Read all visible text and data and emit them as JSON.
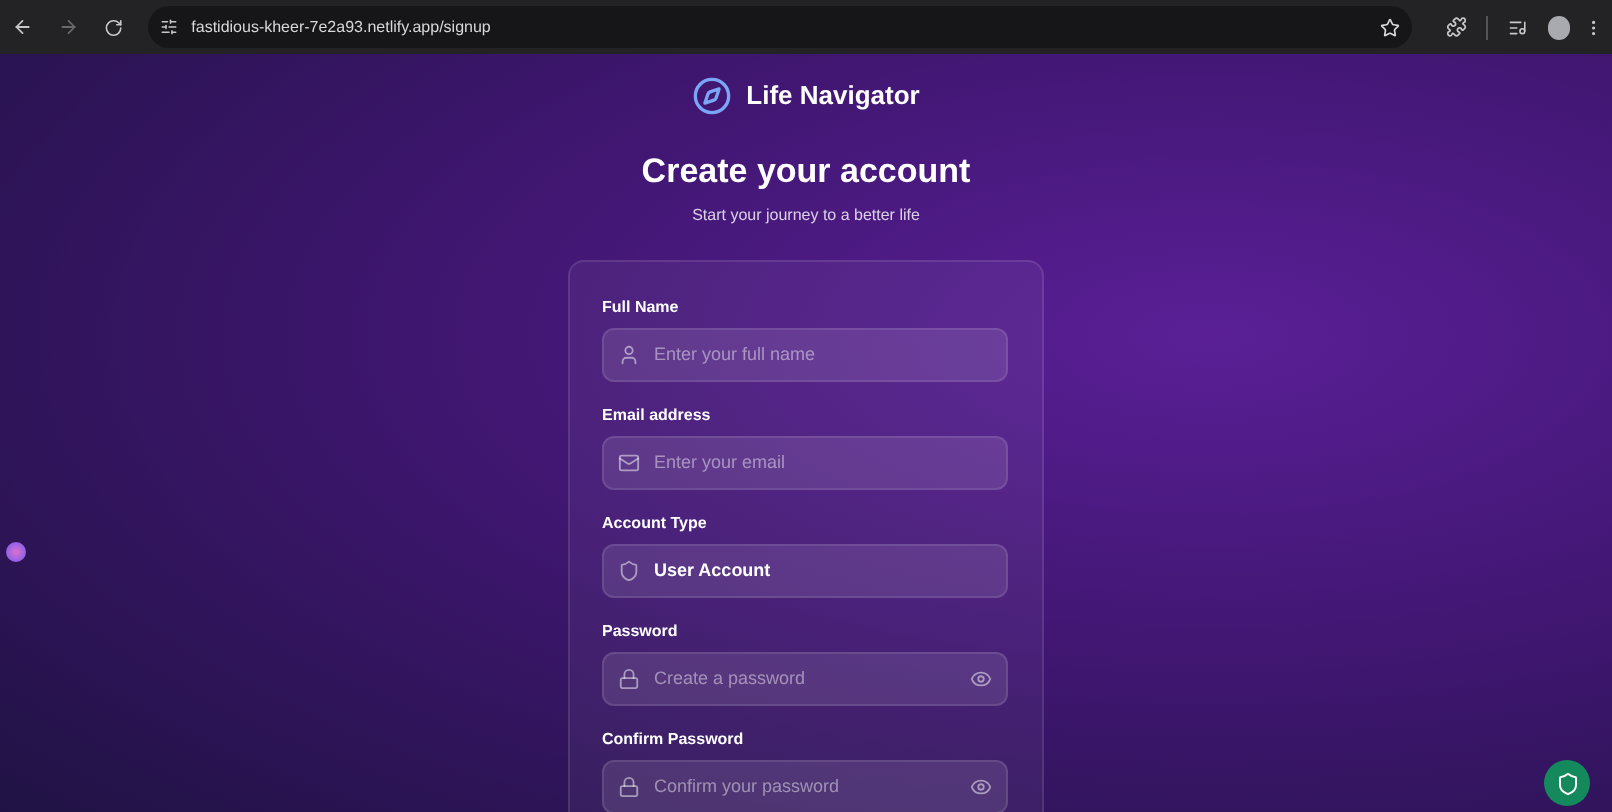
{
  "browser": {
    "url": "fastidious-kheer-7e2a93.netlify.app/signup"
  },
  "brand": {
    "name": "Life Navigator"
  },
  "heading": {
    "title": "Create your account",
    "subtitle": "Start your journey to a better life"
  },
  "fields": [
    {
      "kind": "input",
      "label": "Full Name",
      "placeholder": "Enter your full name"
    },
    {
      "kind": "input",
      "label": "Email address",
      "placeholder": "Enter your email"
    },
    {
      "kind": "select",
      "label": "Account Type",
      "value": "User Account"
    },
    {
      "kind": "password",
      "label": "Password",
      "placeholder": "Create a password"
    },
    {
      "kind": "password",
      "label": "Confirm Password",
      "placeholder": "Confirm your password"
    }
  ]
}
